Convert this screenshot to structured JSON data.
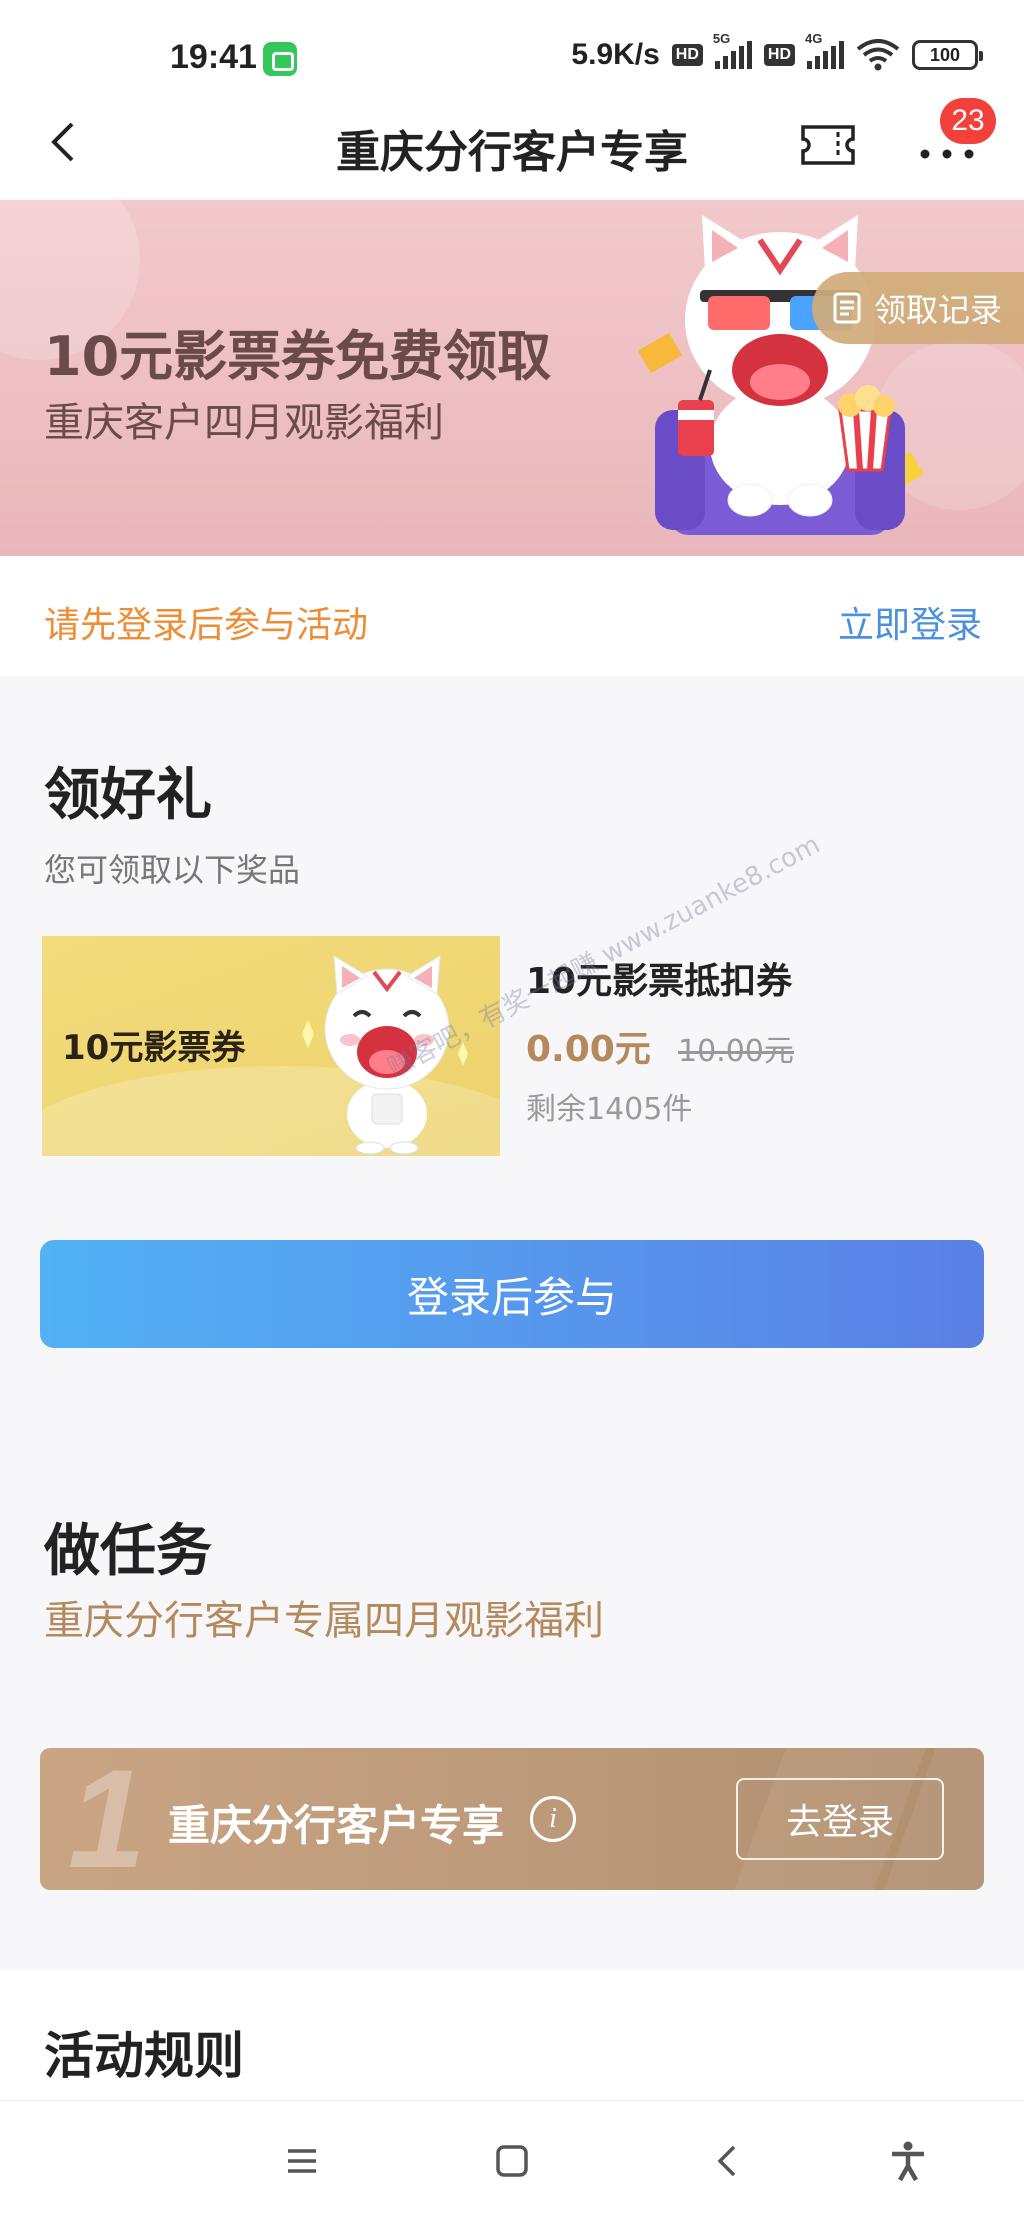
{
  "status_bar": {
    "time": "19:41",
    "net_speed": "5.9K/s",
    "hd_label": "HD",
    "net1": "5G",
    "net2": "4G",
    "battery": "100"
  },
  "header": {
    "title": "重庆分行客户专享",
    "badge_count": "23"
  },
  "banner": {
    "title": "10元影票券免费领取",
    "subtitle": "重庆客户四月观影福利",
    "record_label": "领取记录"
  },
  "login": {
    "hint": "请先登录后参与活动",
    "action": "立即登录"
  },
  "gift_section": {
    "title": "领好礼",
    "subtitle": "您可领取以下奖品",
    "coupon_label": "10元影票券",
    "prize_name": "10元影票抵扣券",
    "price": "0.00元",
    "original_price": "10.00元",
    "stock": "剩余1405件",
    "join_button": "登录后参与"
  },
  "watermark": "赚客吧，有奖一起赚 www.zuanke8.com",
  "task_section": {
    "title": "做任务",
    "subtitle": "重庆分行客户专属四月观影福利",
    "task_number": "1",
    "task_title": "重庆分行客户专享",
    "task_button": "去登录"
  },
  "rules": {
    "title": "活动规则"
  },
  "colors": {
    "accent_orange": "#ee8d35",
    "link_blue": "#4a90e2",
    "gold": "#b48a5c",
    "badge_red": "#f2403a"
  }
}
